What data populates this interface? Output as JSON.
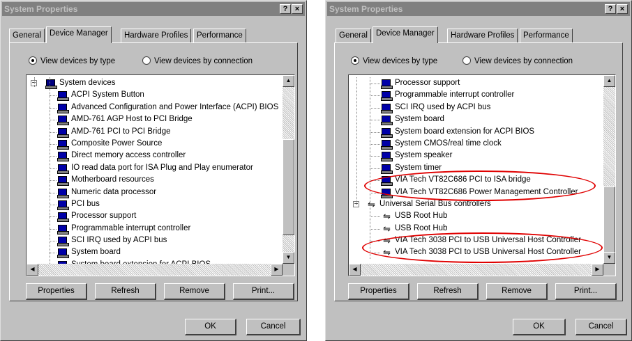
{
  "accent_colors": {
    "highlight": "#e00000",
    "device_icon": "#0000a8"
  },
  "windows": [
    {
      "title": "System Properties",
      "help_glyph": "?",
      "close_glyph": "×",
      "tabs": [
        "General",
        "Device Manager",
        "Hardware Profiles",
        "Performance"
      ],
      "active_tab": "Device Manager",
      "view_by_type_label": "View devices by type",
      "view_by_connection_label": "View devices by connection",
      "view_mode": "type",
      "tree": [
        {
          "label": "System devices",
          "icon": "computer-icon",
          "level": 0,
          "expander": "−"
        },
        {
          "label": "ACPI System Button",
          "icon": "device-icon",
          "level": 1
        },
        {
          "label": "Advanced Configuration and Power Interface (ACPI) BIOS",
          "icon": "device-icon",
          "level": 1
        },
        {
          "label": "AMD-761 AGP Host to PCI Bridge",
          "icon": "device-icon",
          "level": 1
        },
        {
          "label": "AMD-761 PCI to PCI Bridge",
          "icon": "device-icon",
          "level": 1
        },
        {
          "label": "Composite Power Source",
          "icon": "device-icon",
          "level": 1
        },
        {
          "label": "Direct memory access controller",
          "icon": "device-icon",
          "level": 1
        },
        {
          "label": "IO read data port for ISA Plug and Play enumerator",
          "icon": "device-icon",
          "level": 1
        },
        {
          "label": "Motherboard resources",
          "icon": "device-icon",
          "level": 1
        },
        {
          "label": "Numeric data processor",
          "icon": "device-icon",
          "level": 1
        },
        {
          "label": "PCI bus",
          "icon": "device-icon",
          "level": 1
        },
        {
          "label": "Processor support",
          "icon": "device-icon",
          "level": 1
        },
        {
          "label": "Programmable interrupt controller",
          "icon": "device-icon",
          "level": 1
        },
        {
          "label": "SCI IRQ used by ACPI bus",
          "icon": "device-icon",
          "level": 1
        },
        {
          "label": "System board",
          "icon": "device-icon",
          "level": 1
        },
        {
          "label": "System board extension for ACPI BIOS",
          "icon": "device-icon",
          "level": 1
        }
      ],
      "buttons": {
        "properties": "Properties",
        "refresh": "Refresh",
        "remove": "Remove",
        "print": "Print...",
        "ok": "OK",
        "cancel": "Cancel"
      },
      "scroll_position": 0.62
    },
    {
      "title": "System Properties",
      "help_glyph": "?",
      "close_glyph": "×",
      "tabs": [
        "General",
        "Device Manager",
        "Hardware Profiles",
        "Performance"
      ],
      "active_tab": "Device Manager",
      "view_by_type_label": "View devices by type",
      "view_by_connection_label": "View devices by connection",
      "view_mode": "type",
      "tree": [
        {
          "label": "Processor support",
          "icon": "device-icon",
          "level": 1
        },
        {
          "label": "Programmable interrupt controller",
          "icon": "device-icon",
          "level": 1
        },
        {
          "label": "SCI IRQ used by ACPI bus",
          "icon": "device-icon",
          "level": 1
        },
        {
          "label": "System board",
          "icon": "device-icon",
          "level": 1
        },
        {
          "label": "System board extension for ACPI BIOS",
          "icon": "device-icon",
          "level": 1
        },
        {
          "label": "System CMOS/real time clock",
          "icon": "device-icon",
          "level": 1
        },
        {
          "label": "System speaker",
          "icon": "device-icon",
          "level": 1
        },
        {
          "label": "System timer",
          "icon": "device-icon",
          "level": 1
        },
        {
          "label": "VIA Tech VT82C686 PCI to ISA bridge",
          "icon": "device-icon",
          "level": 1
        },
        {
          "label": "VIA Tech VT82C686 Power Management Controller",
          "icon": "device-icon",
          "level": 1
        },
        {
          "label": "Universal Serial Bus controllers",
          "icon": "usb-icon",
          "level": 0,
          "expander": "−"
        },
        {
          "label": "USB Root Hub",
          "icon": "usb-icon",
          "level": 1
        },
        {
          "label": "USB Root Hub",
          "icon": "usb-icon",
          "level": 1
        },
        {
          "label": "VIA Tech 3038 PCI to USB Universal Host Controller",
          "icon": "usb-icon",
          "level": 1
        },
        {
          "label": "VIA Tech 3038 PCI to USB Universal Host Controller",
          "icon": "usb-icon",
          "level": 1
        }
      ],
      "highlighted_rows": [
        [
          8,
          9
        ],
        [
          13,
          14
        ]
      ],
      "buttons": {
        "properties": "Properties",
        "refresh": "Refresh",
        "remove": "Remove",
        "print": "Print...",
        "ok": "OK",
        "cancel": "Cancel"
      },
      "scroll_position": 0.9
    }
  ]
}
